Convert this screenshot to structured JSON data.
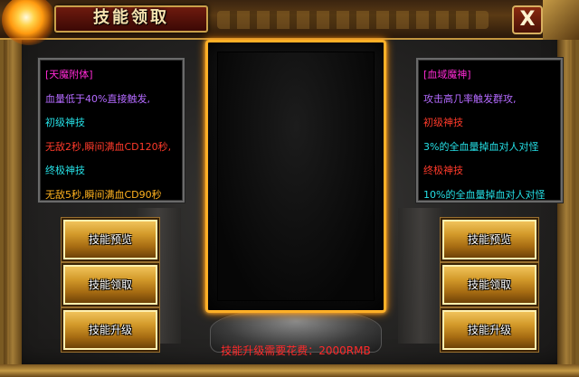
{
  "window": {
    "title": "技能领取",
    "close_label": "X"
  },
  "left_panel": {
    "lines": [
      {
        "text": "[天魔附体]",
        "color": "#ff2ad4"
      },
      {
        "text": "血量低于40%直接触发,",
        "color": "#b46aff"
      },
      {
        "text": "初级神技",
        "color": "#25e0e6"
      },
      {
        "text": "无敌2秒,瞬间满血CD120秒,",
        "color": "#ff3a2a"
      },
      {
        "text": "终极神技",
        "color": "#25e0e6"
      },
      {
        "text": "无敌5秒,瞬间满血CD90秒",
        "color": "#ffb21f"
      }
    ]
  },
  "right_panel": {
    "lines": [
      {
        "text": "[血域魔神]",
        "color": "#ff2ad4"
      },
      {
        "text": "攻击高几率触发群攻,",
        "color": "#b46aff"
      },
      {
        "text": "初级神技",
        "color": "#ff3a2a"
      },
      {
        "text": "3%的全血量掉血对人对怪",
        "color": "#25e0e6"
      },
      {
        "text": "终极神技",
        "color": "#ff3a2a"
      },
      {
        "text": "10%的全血量掉血对人对怪",
        "color": "#25e0e6"
      }
    ]
  },
  "left_buttons": {
    "preview": "技能预览",
    "claim": "技能领取",
    "upgrade": "技能升级"
  },
  "right_buttons": {
    "preview": "技能预览",
    "claim": "技能领取",
    "upgrade": "技能升级"
  },
  "footer": {
    "cost_text": "技能升级需要花费：2000RMB"
  },
  "colors": {
    "accent_gold": "#c4963f",
    "cost_red": "#ff2a2a",
    "portrait_glow": "#ffb027"
  }
}
